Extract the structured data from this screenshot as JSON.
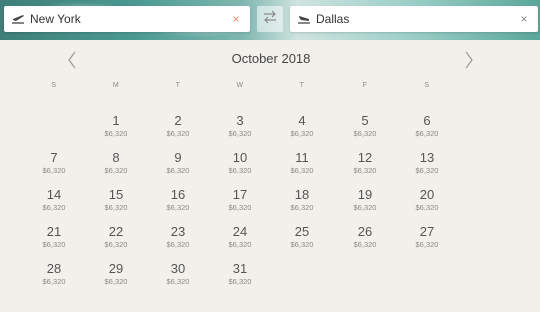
{
  "search": {
    "origin": {
      "value": "New York",
      "icon": "plane-takeoff-icon"
    },
    "destination": {
      "value": "Dallas",
      "icon": "plane-landing-icon"
    },
    "clear_symbol": "×"
  },
  "calendar": {
    "month_label": "October 2018",
    "weekdays": [
      "S",
      "M",
      "T",
      "W",
      "T",
      "F",
      "S"
    ],
    "start_weekday": 1,
    "days": [
      {
        "day": "1",
        "price": "$6,320"
      },
      {
        "day": "2",
        "price": "$6,320"
      },
      {
        "day": "3",
        "price": "$6,320"
      },
      {
        "day": "4",
        "price": "$6,320"
      },
      {
        "day": "5",
        "price": "$6,320"
      },
      {
        "day": "6",
        "price": "$6,320"
      },
      {
        "day": "7",
        "price": "$6,320"
      },
      {
        "day": "8",
        "price": "$6,320"
      },
      {
        "day": "9",
        "price": "$6,320"
      },
      {
        "day": "10",
        "price": "$6,320"
      },
      {
        "day": "11",
        "price": "$6,320"
      },
      {
        "day": "12",
        "price": "$6,320"
      },
      {
        "day": "13",
        "price": "$6,320"
      },
      {
        "day": "14",
        "price": "$6,320"
      },
      {
        "day": "15",
        "price": "$6,320"
      },
      {
        "day": "16",
        "price": "$6,320"
      },
      {
        "day": "17",
        "price": "$6,320"
      },
      {
        "day": "18",
        "price": "$6,320"
      },
      {
        "day": "19",
        "price": "$6,320"
      },
      {
        "day": "20",
        "price": "$6,320"
      },
      {
        "day": "21",
        "price": "$6,320"
      },
      {
        "day": "22",
        "price": "$6,320"
      },
      {
        "day": "23",
        "price": "$6,320"
      },
      {
        "day": "24",
        "price": "$6,320"
      },
      {
        "day": "25",
        "price": "$6,320"
      },
      {
        "day": "26",
        "price": "$6,320"
      },
      {
        "day": "27",
        "price": "$6,320"
      },
      {
        "day": "28",
        "price": "$6,320"
      },
      {
        "day": "29",
        "price": "$6,320"
      },
      {
        "day": "30",
        "price": "$6,320"
      },
      {
        "day": "31",
        "price": "$6,320"
      }
    ]
  },
  "colors": {
    "background": "#f2f0ea",
    "clear_origin": "#e8896a"
  }
}
